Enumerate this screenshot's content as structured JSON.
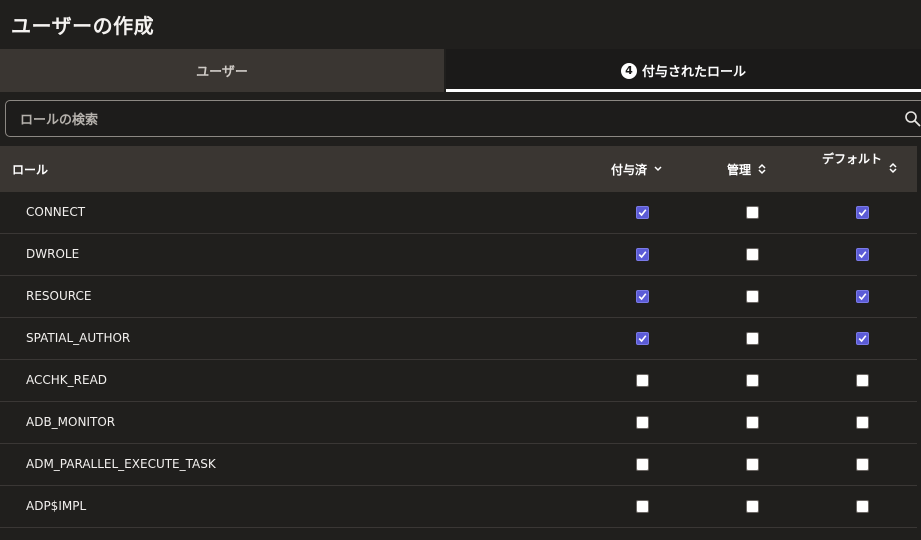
{
  "page": {
    "title": "ユーザーの作成"
  },
  "tabs": [
    {
      "label": "ユーザー",
      "active": false
    },
    {
      "badge": "4",
      "label": "付与されたロール",
      "active": true
    }
  ],
  "search": {
    "placeholder": "ロールの検索",
    "value": ""
  },
  "table": {
    "columns": {
      "role": "ロール",
      "granted": "付与済",
      "admin": "管理",
      "default": "デフォルト"
    },
    "rows": [
      {
        "name": "CONNECT",
        "granted": true,
        "admin": false,
        "default": true
      },
      {
        "name": "DWROLE",
        "granted": true,
        "admin": false,
        "default": true
      },
      {
        "name": "RESOURCE",
        "granted": true,
        "admin": false,
        "default": true
      },
      {
        "name": "SPATIAL_AUTHOR",
        "granted": true,
        "admin": false,
        "default": true
      },
      {
        "name": "ACCHK_READ",
        "granted": false,
        "admin": false,
        "default": false
      },
      {
        "name": "ADB_MONITOR",
        "granted": false,
        "admin": false,
        "default": false
      },
      {
        "name": "ADM_PARALLEL_EXECUTE_TASK",
        "granted": false,
        "admin": false,
        "default": false
      },
      {
        "name": "ADP$IMPL",
        "granted": false,
        "admin": false,
        "default": false
      }
    ]
  },
  "colors": {
    "background": "#201f1d",
    "header": "#3a3632",
    "checkbox_checked": "#5b5bd6"
  }
}
